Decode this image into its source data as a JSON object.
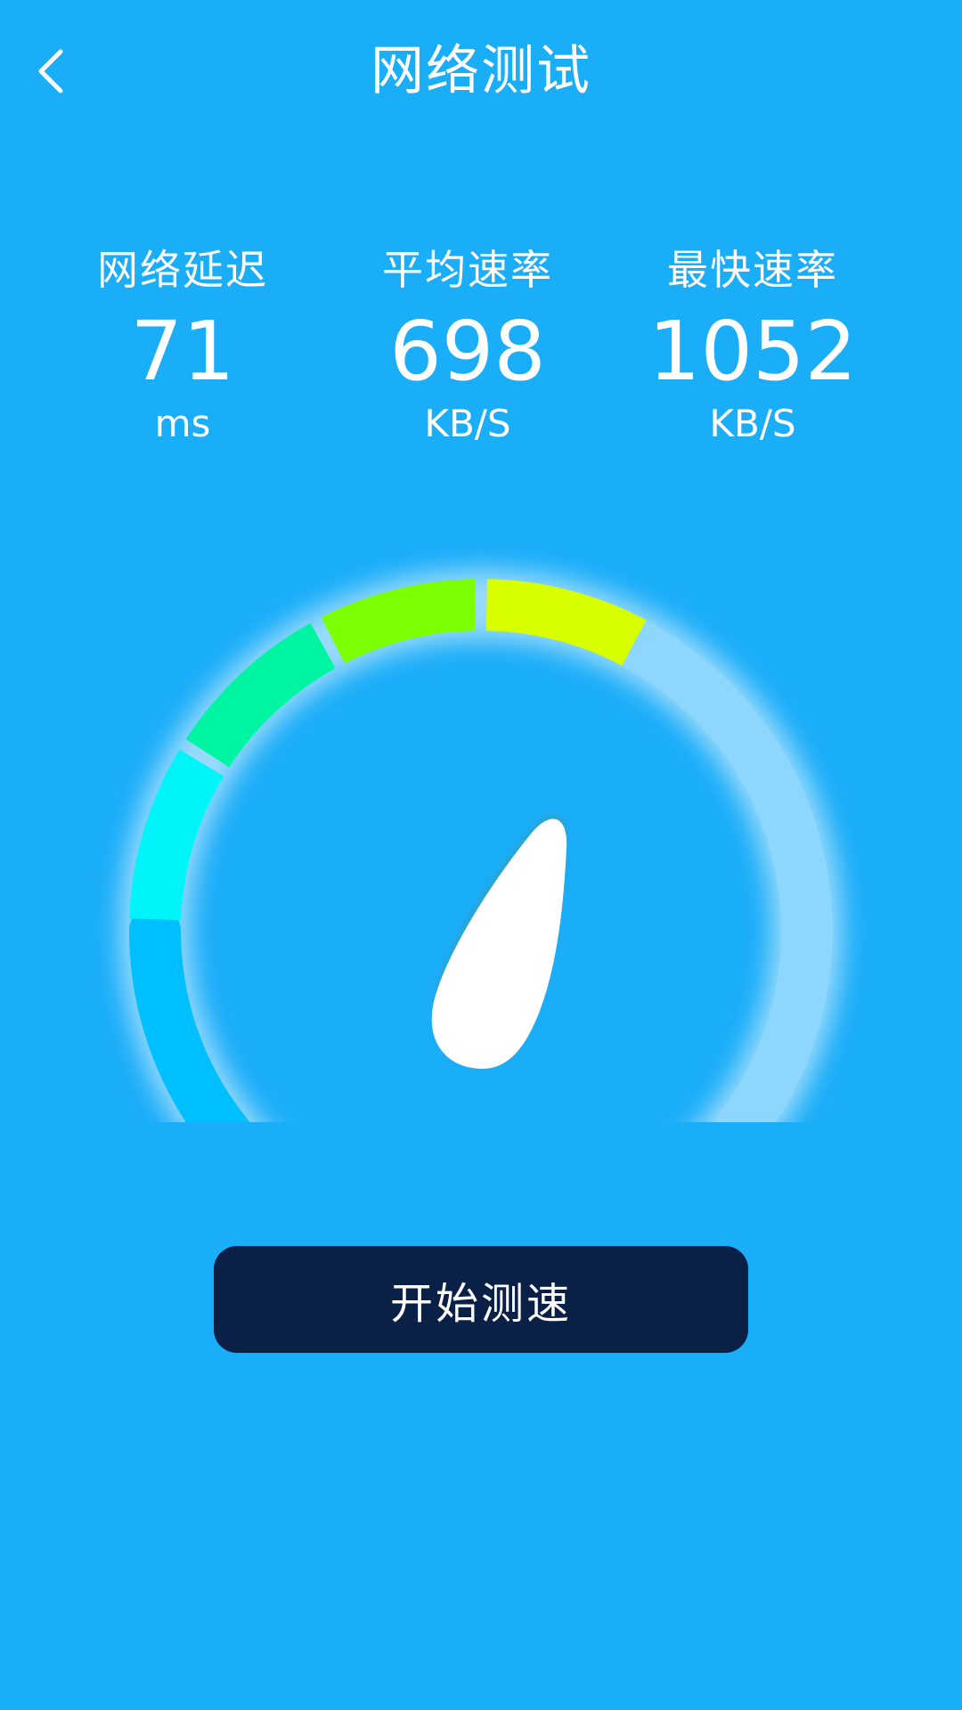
{
  "header": {
    "title": "网络测试",
    "back_icon": "chevron-left-icon"
  },
  "stats": [
    {
      "label": "网络延迟",
      "value": "71",
      "unit": "ms"
    },
    {
      "label": "平均速率",
      "value": "698",
      "unit": "KB/S"
    },
    {
      "label": "最快速率",
      "value": "1052",
      "unit": "KB/S"
    }
  ],
  "gauge": {
    "segment_colors": [
      "#00BFFF",
      "#00F5F8",
      "#00F5A3",
      "#7CFF00",
      "#D8FF00"
    ],
    "track_color": "#8DD7FF",
    "needle_color": "#FFFFFF"
  },
  "action": {
    "start_label": "开始测速"
  },
  "colors": {
    "background": "#1AADF8",
    "button_background": "#0B2046"
  }
}
